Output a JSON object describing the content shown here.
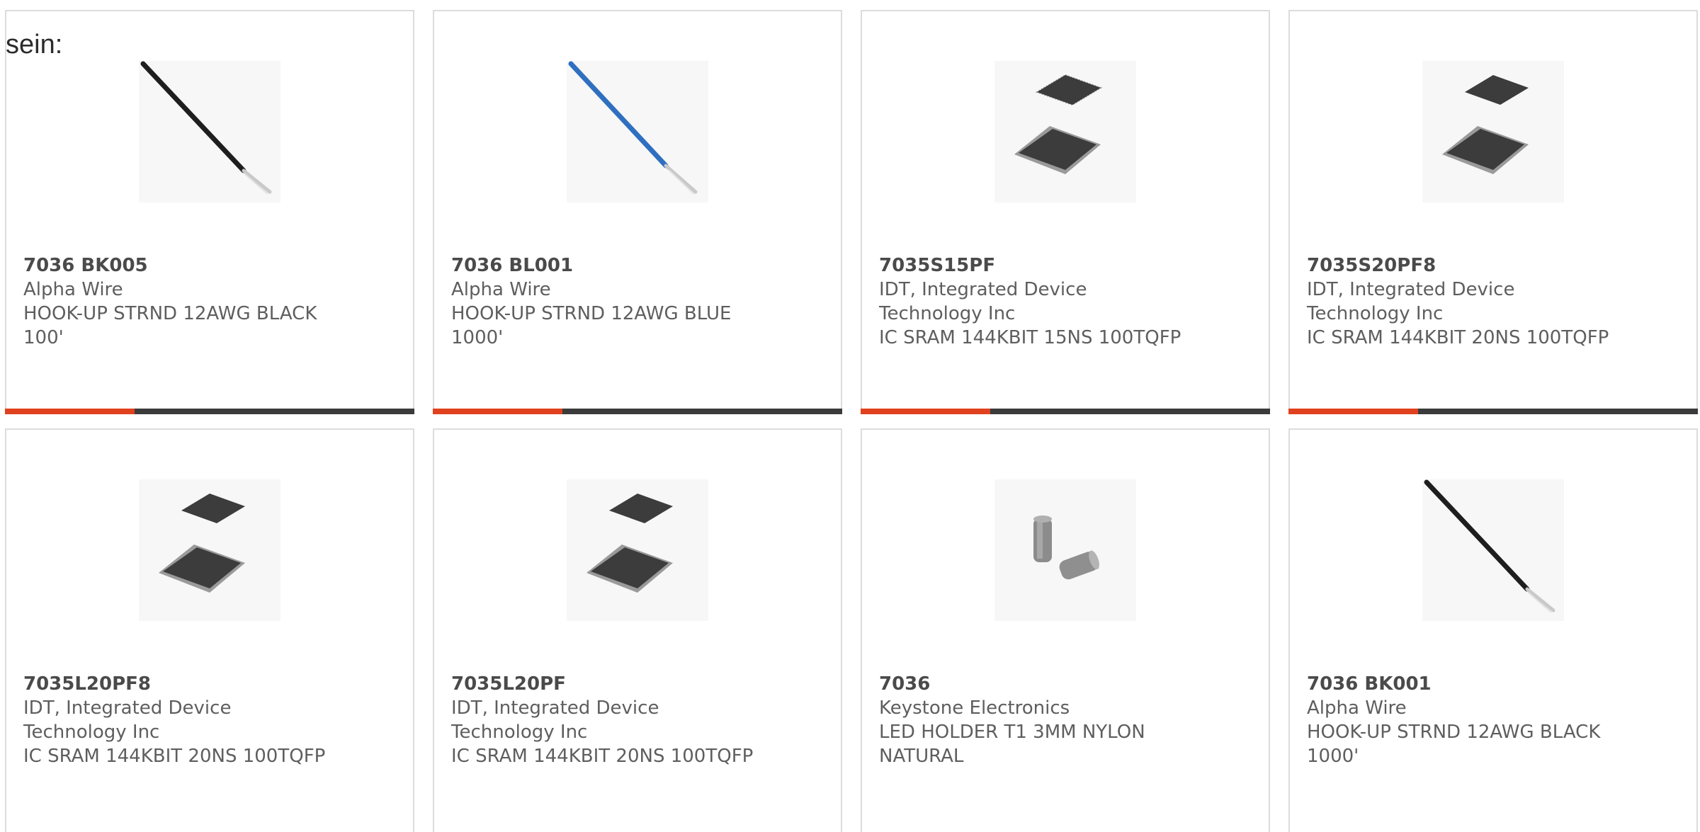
{
  "heading": "sein:",
  "colors": {
    "accent": "#e0411e",
    "bar_dark": "#3b3b3b",
    "border": "#dcdcdc",
    "text": "#5e5e5e"
  },
  "products": [
    {
      "part": "7036 BK005",
      "maker": "Alpha Wire",
      "desc1": "HOOK-UP STRND 12AWG BLACK",
      "desc2": "100'",
      "desc3": "",
      "image": "black-wire-image"
    },
    {
      "part": "7036 BL001",
      "maker": "Alpha Wire",
      "desc1": "HOOK-UP STRND 12AWG BLUE",
      "desc2": "1000'",
      "desc3": "",
      "image": "blue-wire-image"
    },
    {
      "part": "7035S15PF",
      "maker": "IDT, Integrated Device",
      "desc1": "Technology Inc",
      "desc2": "IC SRAM 144KBIT 15NS 100TQFP",
      "desc3": "",
      "image": "ic-chip-image"
    },
    {
      "part": "7035S20PF8",
      "maker": "IDT, Integrated Device",
      "desc1": "Technology Inc",
      "desc2": "IC SRAM 144KBIT 20NS 100TQFP",
      "desc3": "",
      "image": "ic-chip-image"
    },
    {
      "part": "7035L20PF8",
      "maker": "IDT, Integrated Device",
      "desc1": "Technology Inc",
      "desc2": "IC SRAM 144KBIT 20NS 100TQFP",
      "desc3": "",
      "image": "ic-chip-image"
    },
    {
      "part": "7035L20PF",
      "maker": "IDT, Integrated Device",
      "desc1": "Technology Inc",
      "desc2": "IC SRAM 144KBIT 20NS 100TQFP",
      "desc3": "",
      "image": "ic-chip-image"
    },
    {
      "part": "7036",
      "maker": "Keystone Electronics",
      "desc1": "LED HOLDER T1 3MM NYLON",
      "desc2": "NATURAL",
      "desc3": "",
      "image": "led-holder-image"
    },
    {
      "part": "7036 BK001",
      "maker": "Alpha Wire",
      "desc1": "HOOK-UP STRND 12AWG BLACK",
      "desc2": "1000'",
      "desc3": "",
      "image": "black-wire-image"
    }
  ]
}
